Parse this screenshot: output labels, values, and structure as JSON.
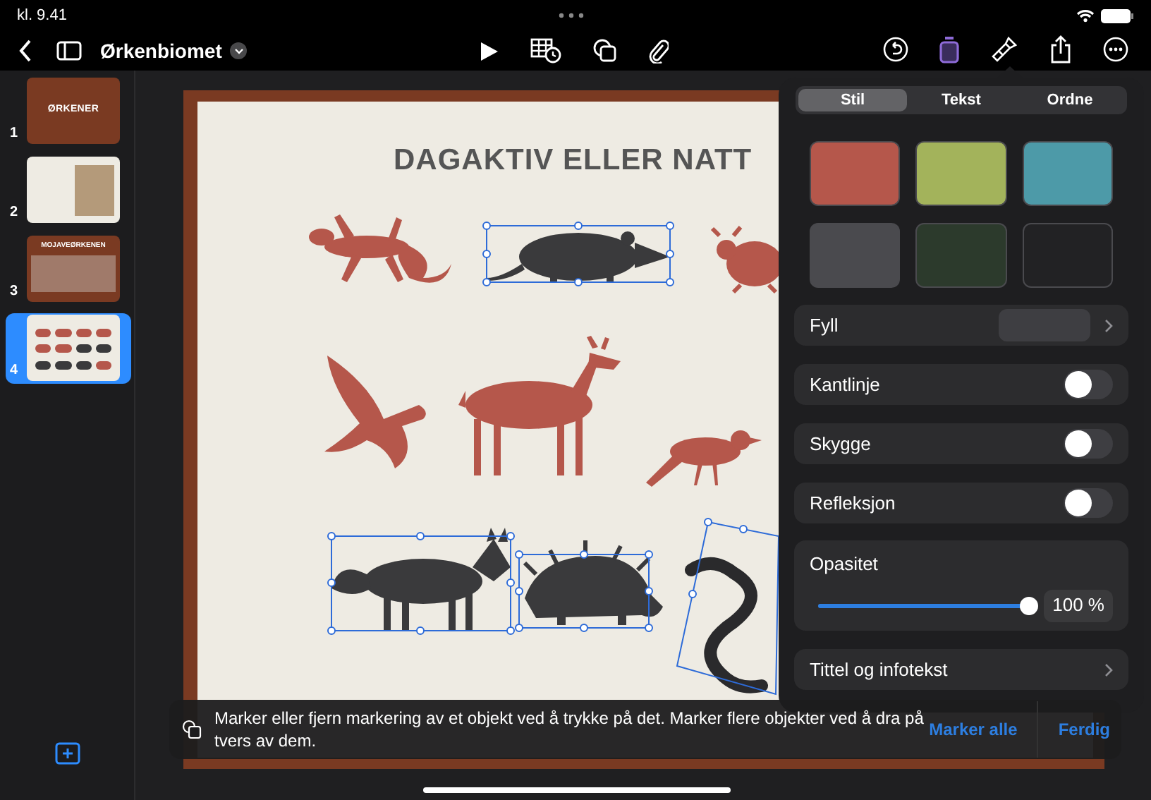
{
  "status_bar": {
    "time": "kl. 9.41"
  },
  "toolbar": {
    "document_title": "Ørkenbiomet"
  },
  "slides": [
    {
      "number": "1",
      "kind": "title",
      "title": "ØRKENER",
      "selected": false
    },
    {
      "number": "2",
      "kind": "photo",
      "selected": false
    },
    {
      "number": "3",
      "kind": "title-photo",
      "title": "MOJAVEØRKENEN",
      "selected": false
    },
    {
      "number": "4",
      "kind": "animals",
      "selected": true
    }
  ],
  "slide": {
    "title": "DAGAKTIV ELLER NATT"
  },
  "format_panel": {
    "tabs": [
      {
        "label": "Stil",
        "selected": true
      },
      {
        "label": "Tekst",
        "selected": false
      },
      {
        "label": "Ordne",
        "selected": false
      }
    ],
    "swatches": [
      {
        "color": "#b5574b"
      },
      {
        "color": "#a3b35b"
      },
      {
        "color": "#4d9aa8"
      },
      {
        "color": "#4a4a4e"
      },
      {
        "color": "#2c3a2c"
      },
      {
        "color": "#222224"
      }
    ],
    "fill": {
      "label": "Fyll"
    },
    "toggles": [
      {
        "label": "Kantlinje",
        "on": false
      },
      {
        "label": "Skygge",
        "on": false
      },
      {
        "label": "Refleksjon",
        "on": false
      }
    ],
    "opacity": {
      "label": "Opasitet",
      "level": 1,
      "reading": "100 %"
    },
    "caption_row": {
      "label": "Tittel og infotekst"
    }
  },
  "hint_bar": {
    "text": "Marker eller fjern markering av et objekt ved å trykke på det. Marker flere objekter ved å dra på tvers av dem.",
    "actions": [
      "Marker alle",
      "Ferdig"
    ]
  }
}
